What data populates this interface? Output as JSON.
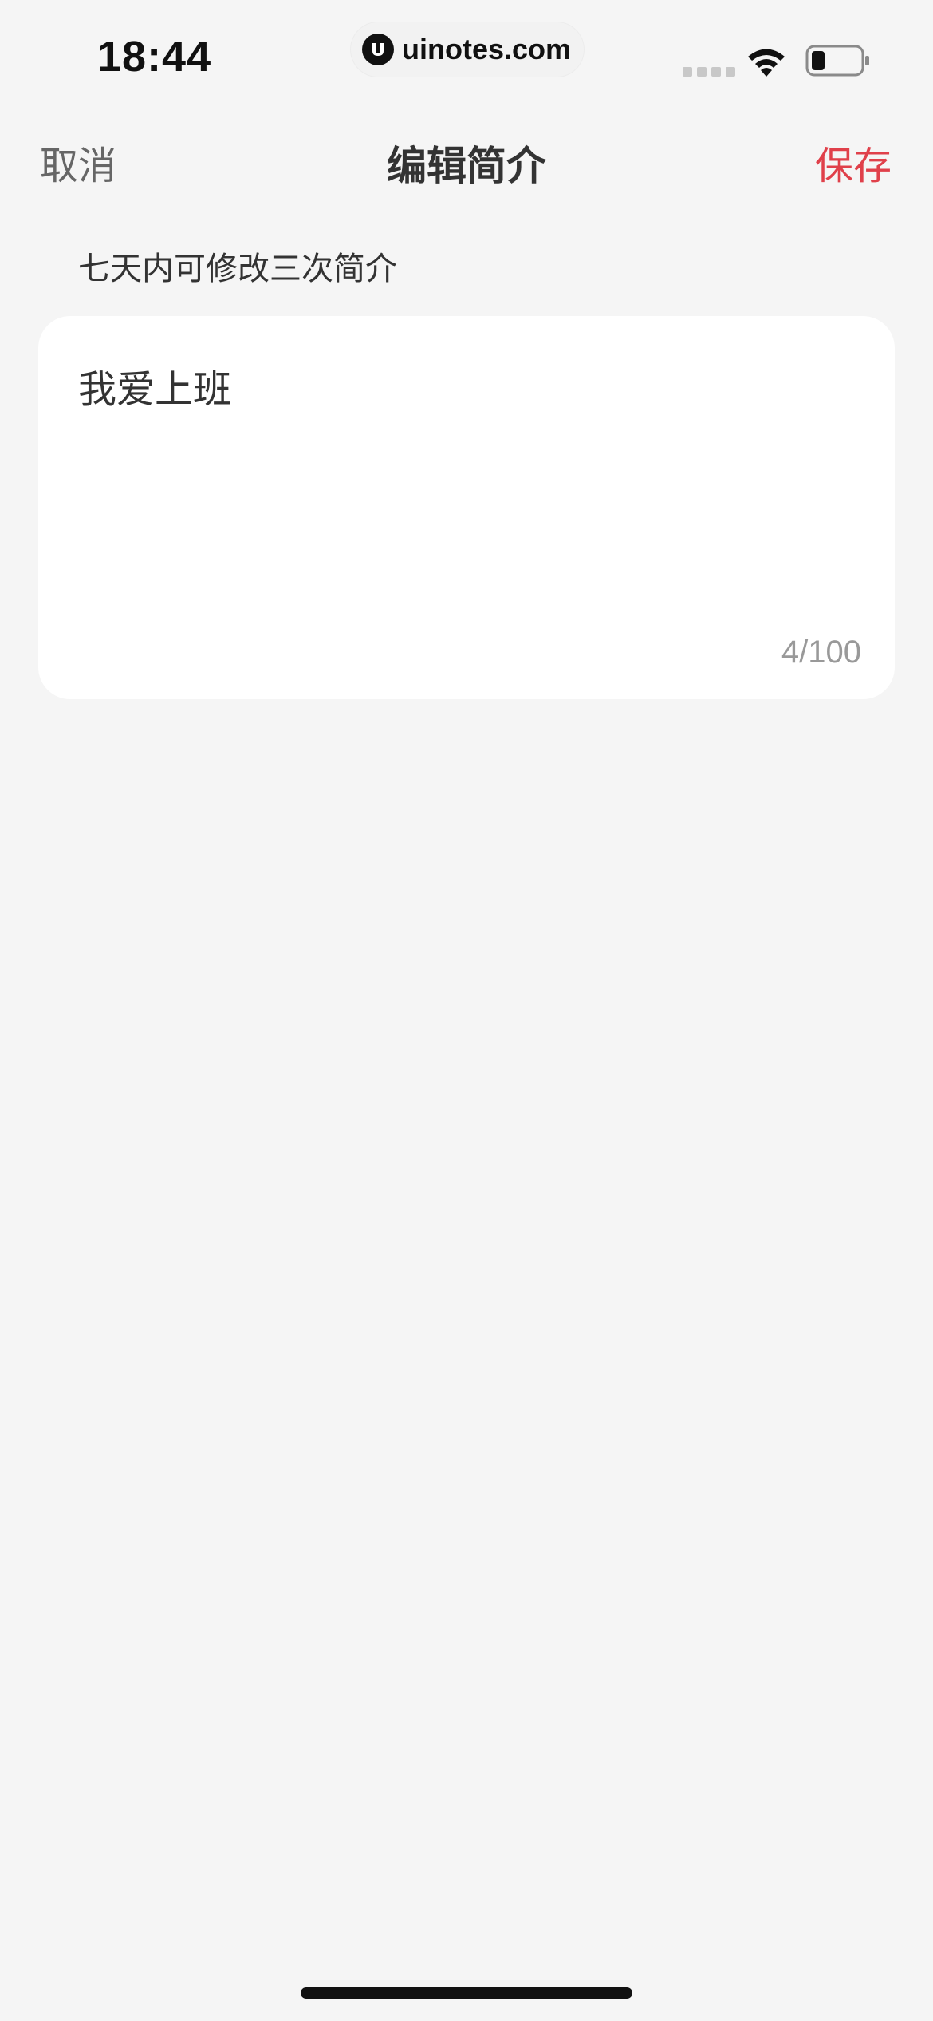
{
  "status_bar": {
    "time": "18:44",
    "watermark": "uinotes.com",
    "icons": [
      "signal-icon",
      "wifi-icon",
      "battery-icon"
    ]
  },
  "nav": {
    "cancel_label": "取消",
    "title": "编辑简介",
    "save_label": "保存"
  },
  "hint": "七天内可修改三次简介",
  "bio": {
    "value": "我爱上班",
    "char_count": "4/100"
  },
  "colors": {
    "background": "#f5f5f5",
    "card": "#ffffff",
    "accent_red": "#e0404a",
    "muted_text": "#999999"
  }
}
